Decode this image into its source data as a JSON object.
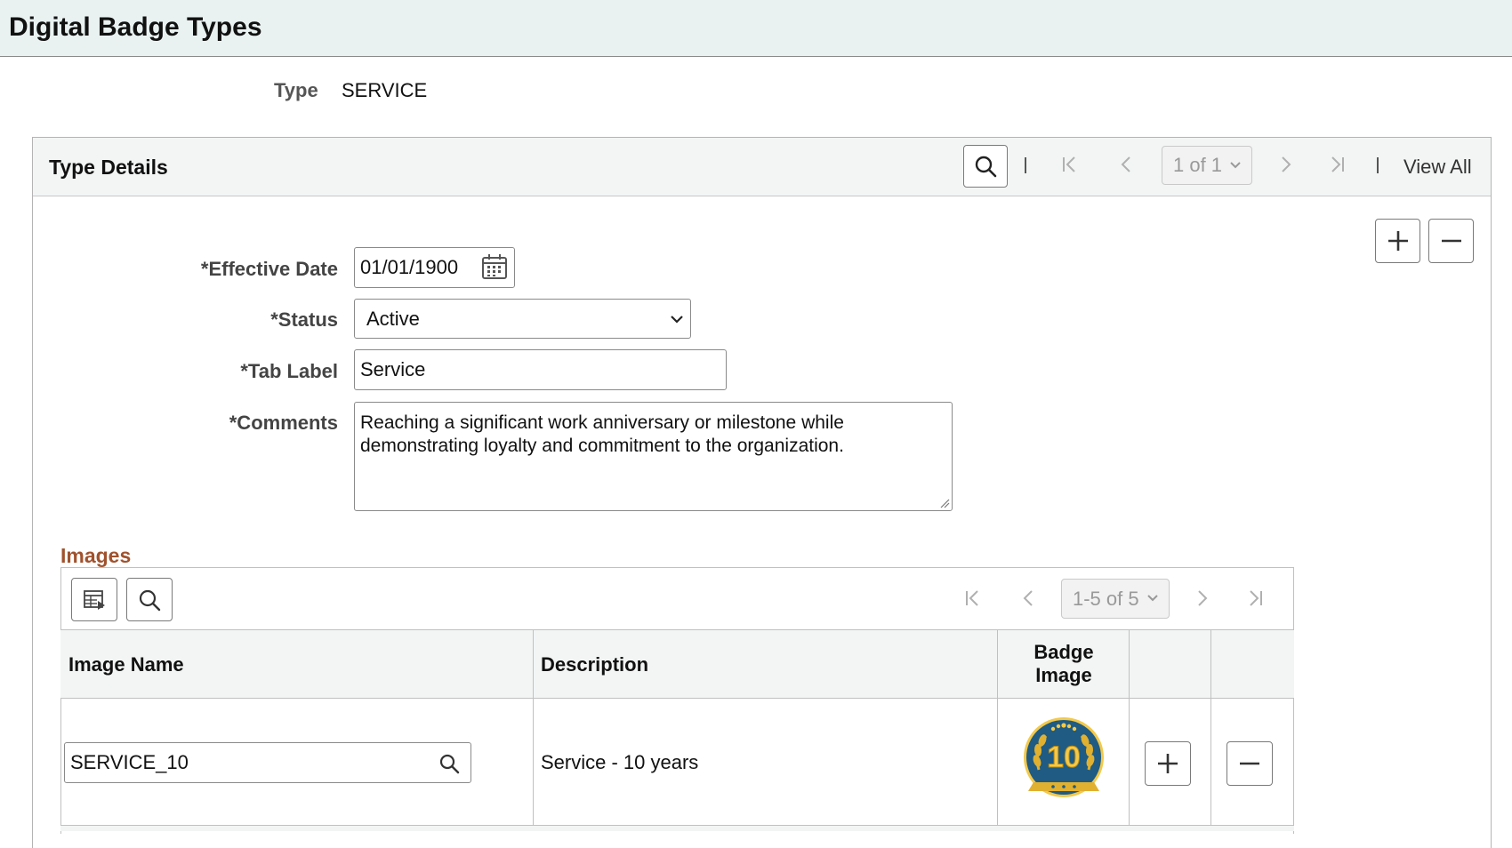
{
  "page": {
    "title": "Digital Badge Types"
  },
  "type_field": {
    "label": "Type",
    "value": "SERVICE"
  },
  "details": {
    "title": "Type Details",
    "pager_text": "1 of 1",
    "view_all": "View All",
    "effective_date": {
      "label": "*Effective Date",
      "value": "01/01/1900"
    },
    "status": {
      "label": "*Status",
      "value": "Active"
    },
    "tab_label": {
      "label": "*Tab Label",
      "value": "Service"
    },
    "comments": {
      "label": "*Comments",
      "value": "Reaching a significant work anniversary or milestone while demonstrating loyalty and commitment to the organization."
    }
  },
  "images": {
    "title": "Images",
    "pager_text": "1-5 of 5",
    "columns": {
      "image_name": "Image Name",
      "description": "Description",
      "badge_image_line1": "Badge",
      "badge_image_line2": "Image"
    },
    "rows": [
      {
        "image_name": "SERVICE_10",
        "description": "Service - 10 years",
        "badge_number": "10"
      }
    ]
  },
  "colors": {
    "header_bg": "#e9f1f1",
    "section_title": "#a0522d",
    "badge_blue": "#1f5b82",
    "badge_gold": "#d9a520"
  }
}
